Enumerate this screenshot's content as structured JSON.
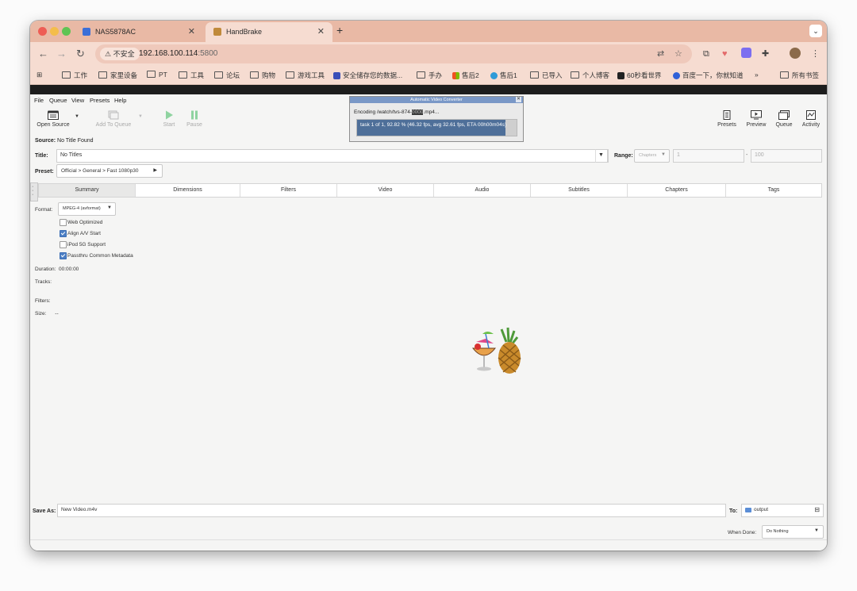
{
  "browser": {
    "tabs": [
      {
        "title": "NAS5878AC",
        "active": false
      },
      {
        "title": "HandBrake",
        "active": true
      }
    ],
    "address": {
      "security_label": "不安全",
      "host": "192.168.100.114",
      "port": ":5800"
    },
    "bookmarks": [
      {
        "label": "工作",
        "kind": "folder"
      },
      {
        "label": "家里设备",
        "kind": "folder"
      },
      {
        "label": "PT",
        "kind": "folder"
      },
      {
        "label": "工具",
        "kind": "folder"
      },
      {
        "label": "论坛",
        "kind": "folder"
      },
      {
        "label": "购物",
        "kind": "folder"
      },
      {
        "label": "游戏工具",
        "kind": "folder"
      },
      {
        "label": "安全储存您的数据...",
        "kind": "site"
      },
      {
        "label": "手办",
        "kind": "folder"
      },
      {
        "label": "售后2",
        "kind": "site"
      },
      {
        "label": "售后1",
        "kind": "site"
      },
      {
        "label": "已导入",
        "kind": "folder"
      },
      {
        "label": "个人博客",
        "kind": "folder"
      },
      {
        "label": "60秒看世界",
        "kind": "site"
      },
      {
        "label": "百度一下，你就知道",
        "kind": "site"
      },
      {
        "label": "»",
        "kind": "more"
      },
      {
        "label": "所有书签",
        "kind": "folder"
      }
    ]
  },
  "app": {
    "menu": [
      "File",
      "Queue",
      "View",
      "Presets",
      "Help"
    ],
    "toolbar_left": [
      {
        "label": "Open Source",
        "enabled": true
      },
      {
        "label": "Add To Queue",
        "enabled": false
      },
      {
        "label": "Start",
        "enabled": false
      },
      {
        "label": "Pause",
        "enabled": false
      }
    ],
    "toolbar_right": [
      {
        "label": "Presets"
      },
      {
        "label": "Preview"
      },
      {
        "label": "Queue"
      },
      {
        "label": "Activity"
      }
    ],
    "source": {
      "label": "Source:",
      "value": "No Title Found"
    },
    "title": {
      "label": "Title:",
      "value": "No Titles"
    },
    "range": {
      "label": "Range:",
      "mode": "Chapters",
      "start": "1",
      "end": "100",
      "dash": "-"
    },
    "preset": {
      "label": "Preset:",
      "value": "Official > General > Fast 1080p30"
    },
    "tabs": [
      "Summary",
      "Dimensions",
      "Filters",
      "Video",
      "Audio",
      "Subtitles",
      "Chapters",
      "Tags"
    ],
    "summary": {
      "format_label": "Format:",
      "format_value": "MPEG-4 (avformat)",
      "options": [
        {
          "label": "Web Optimized",
          "checked": false
        },
        {
          "label": "Align A/V Start",
          "checked": true
        },
        {
          "label": "iPod 5G Support",
          "checked": false
        },
        {
          "label": "Passthru Common Metadata",
          "checked": true
        }
      ],
      "duration_label": "Duration:",
      "duration_value": "00:00:00",
      "tracks_label": "Tracks:",
      "filters_label": "Filters:",
      "size_label": "Size:",
      "size_value": "--"
    },
    "save_as": {
      "label": "Save As:",
      "value": "New Video.m4v"
    },
    "to": {
      "label": "To:",
      "value": "output"
    },
    "when_done": {
      "label": "When Done:",
      "value": "Do Nothing"
    }
  },
  "dialog": {
    "title": "Automatic Video Converter",
    "encoding_text": "Encoding /watch/tvs-874-",
    "encoding_redacted": "0000",
    "encoding_suffix": ".mp4...",
    "progress_text": "task 1 of 1, 92.82 % (46.32 fps, avg 32.61 fps, ETA 00h00m04s)",
    "progress": 0.9282
  },
  "colors": {
    "tab_strip": "#e9b9a5",
    "toolbar": "#f6dcd1",
    "progress_fill": "#4e6f99",
    "dialog_titlebar": "#7a98c7",
    "checkbox_on": "#4d7fc4"
  }
}
